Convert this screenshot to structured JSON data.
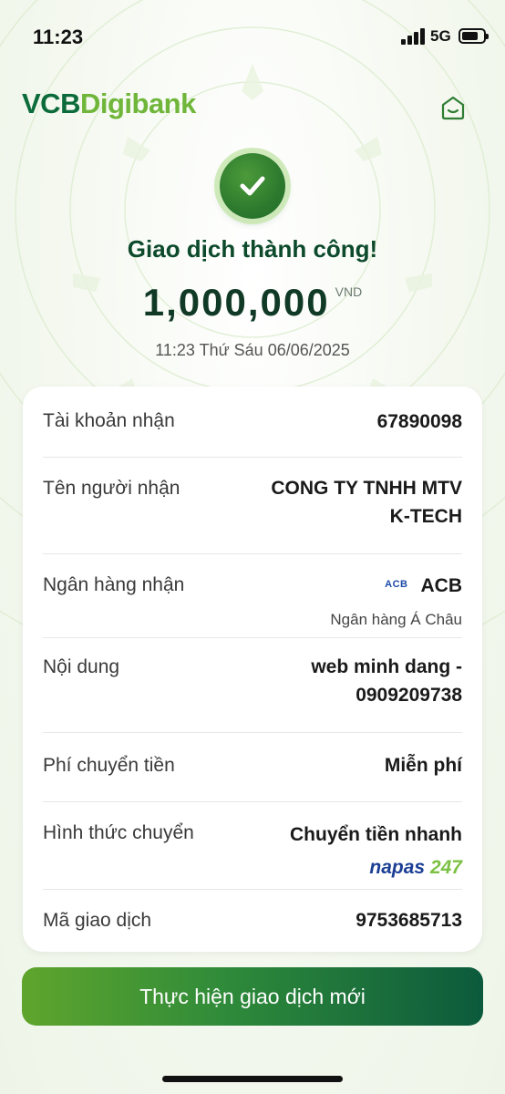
{
  "status_bar": {
    "time": "11:23",
    "network": "5G"
  },
  "header": {
    "logo_part1": "VCB",
    "logo_part2": "Digibank"
  },
  "result": {
    "title": "Giao dịch thành công!",
    "amount": "1,000,000",
    "currency": "VND",
    "datetime": "11:23 Thứ Sáu 06/06/2025"
  },
  "details": {
    "account": {
      "label": "Tài khoản nhận",
      "value": "67890098"
    },
    "recipient": {
      "label": "Tên người nhận",
      "value_line1": "CONG TY TNHH MTV",
      "value_line2": "K-TECH"
    },
    "bank": {
      "label": "Ngân hàng nhận",
      "logo_text": "ACB",
      "value": "ACB",
      "sub": "Ngân hàng Á Châu"
    },
    "content": {
      "label": "Nội dung",
      "value_line1": "web minh dang -",
      "value_line2": "0909209738"
    },
    "fee": {
      "label": "Phí chuyển tiền",
      "value": "Miễn phí"
    },
    "method": {
      "label": "Hình thức chuyển",
      "value": "Chuyển tiền nhanh",
      "napas_part1": "napas",
      "napas_part2": "247"
    },
    "transaction_id": {
      "label": "Mã giao dịch",
      "value": "9753685713"
    }
  },
  "actions": {
    "new_transaction_label": "Thực hiện giao dịch mới"
  },
  "colors": {
    "brand_dark": "#0b6b3a",
    "brand_light": "#6fb63a",
    "napas_blue": "#1c3f95",
    "napas_green": "#7bc143"
  },
  "icons": {
    "home": "home-icon",
    "success": "checkmark-icon"
  }
}
